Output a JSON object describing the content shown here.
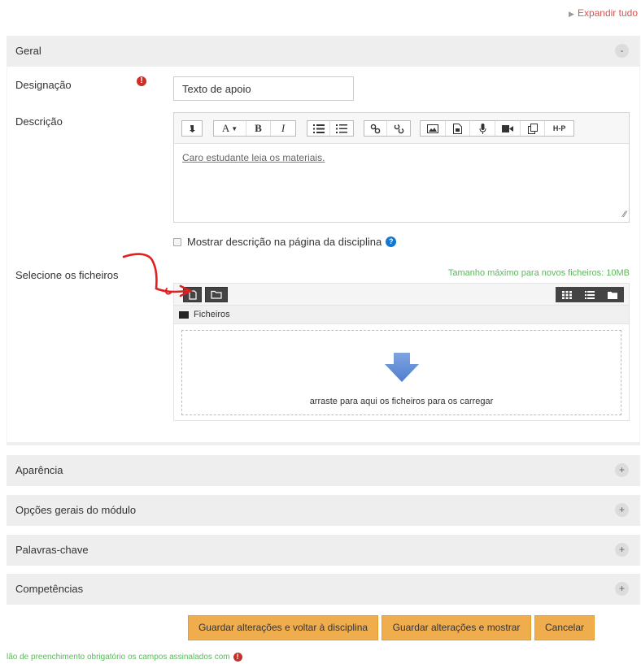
{
  "header": {
    "expand_all": "Expandir tudo"
  },
  "sections": {
    "geral": {
      "title": "Geral",
      "toggle": "-"
    },
    "aparencia": {
      "title": "Aparência",
      "toggle": "+"
    },
    "opcoes": {
      "title": "Opções gerais do módulo",
      "toggle": "+"
    },
    "palavras": {
      "title": "Palavras-chave",
      "toggle": "+"
    },
    "competencias": {
      "title": "Competências",
      "toggle": "+"
    }
  },
  "form": {
    "designacao_label": "Designação",
    "designacao_value": "Texto de apoio",
    "descricao_label": "Descrição",
    "descricao_text": "Caro estudante leia os materiais.",
    "mostrar_descricao_label": "Mostrar descrição na página da disciplina",
    "selecione_label": "Selecione os ficheiros",
    "max_size": "Tamanho máximo para novos ficheiros: 10MB",
    "folder_path": "Ficheiros",
    "drop_message": "arraste para aqui os ficheiros para os carregar",
    "required_icon": "!",
    "help_icon": "?"
  },
  "toolbar": {
    "font_button": "A",
    "bold": "B",
    "italic": "I",
    "h5p": "H-P",
    "icons": [
      "expand-toolbar-icon",
      "font-size-icon",
      "bold-icon",
      "italic-icon",
      "unordered-list-icon",
      "ordered-list-icon",
      "link-icon",
      "unlink-icon",
      "image-icon",
      "media-icon",
      "record-audio-icon",
      "record-video-icon",
      "manage-files-icon",
      "h5p-icon"
    ]
  },
  "actions": {
    "save_return": "Guardar alterações e voltar à disciplina",
    "save_display": "Guardar alterações e mostrar",
    "cancel": "Cancelar"
  },
  "footer": {
    "required_note": "lão de preenchimento obrigatório os campos assinalados com"
  },
  "colors": {
    "required": "#c9302c",
    "accent_button": "#f0ad4e",
    "success": "#5cb85c",
    "link_red": "#d9534f",
    "annotation": "#e02020"
  }
}
